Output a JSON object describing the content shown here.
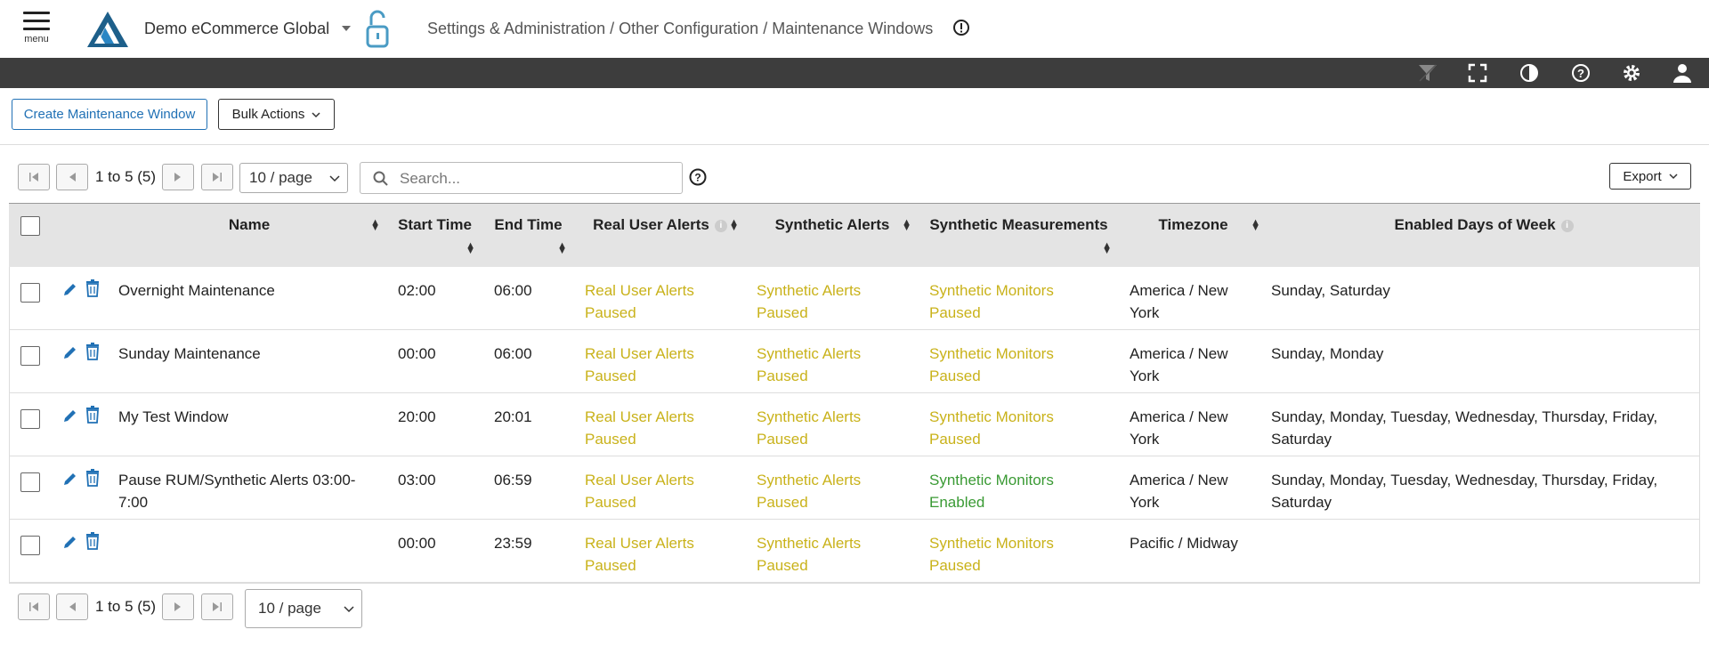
{
  "header": {
    "menu_label": "menu",
    "app_title": "Demo eCommerce Global",
    "breadcrumb": "Settings & Administration / Other Configuration / Maintenance Windows"
  },
  "toolbar": {
    "create_label": "Create Maintenance Window",
    "bulk_label": "Bulk Actions",
    "export_label": "Export",
    "search_placeholder": "Search...",
    "range_text": "1 to 5 (5)",
    "page_size": "10 / page"
  },
  "colors": {
    "accent": "#2171b5",
    "paused": "#c9b21a",
    "enabled": "#3a9a34",
    "topbar": "#3d3d3d"
  },
  "table": {
    "headers": [
      "Name",
      "Start Time",
      "End Time",
      "Real User Alerts",
      "Synthetic Alerts",
      "Synthetic Measurements",
      "Timezone",
      "Enabled Days of Week"
    ],
    "rows": [
      {
        "name": "Overnight Maintenance",
        "start": "02:00",
        "end": "06:00",
        "rum": "Real User Alerts Paused",
        "synth": "Synthetic Alerts Paused",
        "measure": "Synthetic Monitors Paused",
        "measure_status": "paused",
        "tz": "America / New York",
        "days": "Sunday, Saturday"
      },
      {
        "name": "Sunday Maintenance",
        "start": "00:00",
        "end": "06:00",
        "rum": "Real User Alerts Paused",
        "synth": "Synthetic Alerts Paused",
        "measure": "Synthetic Monitors Paused",
        "measure_status": "paused",
        "tz": "America / New York",
        "days": "Sunday, Monday"
      },
      {
        "name": "My Test Window",
        "start": "20:00",
        "end": "20:01",
        "rum": "Real User Alerts Paused",
        "synth": "Synthetic Alerts Paused",
        "measure": "Synthetic Monitors Paused",
        "measure_status": "paused",
        "tz": "America / New York",
        "days": "Sunday, Monday, Tuesday, Wednesday, Thursday, Friday, Saturday"
      },
      {
        "name": "Pause RUM/Synthetic Alerts 03:00-7:00",
        "start": "03:00",
        "end": "06:59",
        "rum": "Real User Alerts Paused",
        "synth": "Synthetic Alerts Paused",
        "measure": "Synthetic Monitors Enabled",
        "measure_status": "enabled",
        "tz": "America / New York",
        "days": "Sunday, Monday, Tuesday, Wednesday, Thursday, Friday, Saturday"
      },
      {
        "name": "",
        "start": "00:00",
        "end": "23:59",
        "rum": "Real User Alerts Paused",
        "synth": "Synthetic Alerts Paused",
        "measure": "Synthetic Monitors Paused",
        "measure_status": "paused",
        "tz": "Pacific / Midway",
        "days": ""
      }
    ]
  }
}
